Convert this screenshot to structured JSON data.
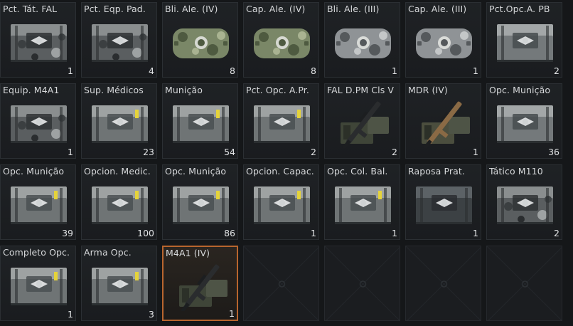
{
  "inventory": {
    "slots": [
      {
        "name": "Pct. Tát. FAL",
        "count": "1",
        "icon": "camo-crate-icon"
      },
      {
        "name": "Pct. Eqp. Pad.",
        "count": "4",
        "icon": "camo-crate-icon"
      },
      {
        "name": "Bli. Ale. (IV)",
        "count": "8",
        "icon": "green-camo-bag-icon"
      },
      {
        "name": "Cap. Ale. (IV)",
        "count": "8",
        "icon": "green-camo-bag-icon"
      },
      {
        "name": "Bli. Ale. (III)",
        "count": "1",
        "icon": "grey-camo-bag-icon"
      },
      {
        "name": "Cap. Ale. (III)",
        "count": "1",
        "icon": "grey-camo-bag-icon"
      },
      {
        "name": "Pct.Opc.A. PB",
        "count": "2",
        "icon": "metal-crate-icon"
      },
      {
        "name": "Equip. M4A1",
        "count": "1",
        "icon": "camo-crate-icon"
      },
      {
        "name": "Sup. Médicos",
        "count": "23",
        "icon": "ammo-crate-icon"
      },
      {
        "name": "Munição",
        "count": "54",
        "icon": "ammo-crate-icon"
      },
      {
        "name": "Pct. Opc. A.Pr.",
        "count": "2",
        "icon": "ammo-crate-icon"
      },
      {
        "name": "FAL D.PM Cls V",
        "count": "2",
        "icon": "rifle-crate-icon"
      },
      {
        "name": "MDR (IV)",
        "count": "1",
        "icon": "rifle-crate-tan-icon"
      },
      {
        "name": "Opc. Munição",
        "count": "36",
        "icon": "metal-crate-icon"
      },
      {
        "name": "Opc. Munição",
        "count": "39",
        "icon": "ammo-crate-icon"
      },
      {
        "name": "Opcion. Medic.",
        "count": "100",
        "icon": "ammo-crate-icon"
      },
      {
        "name": "Opc. Munição",
        "count": "86",
        "icon": "ammo-crate-icon"
      },
      {
        "name": "Opcion. Capac.",
        "count": "1",
        "icon": "ammo-crate-icon"
      },
      {
        "name": "Opc. Col. Bal.",
        "count": "1",
        "icon": "ammo-crate-icon"
      },
      {
        "name": "Raposa Prat.",
        "count": "1",
        "icon": "dark-case-icon"
      },
      {
        "name": "Tático M110",
        "count": "2",
        "icon": "camo-crate-icon"
      },
      {
        "name": "Completo Opc.",
        "count": "1",
        "icon": "ammo-crate-icon"
      },
      {
        "name": "Arma Opc.",
        "count": "3",
        "icon": "ammo-crate-icon"
      },
      {
        "name": "M4A1 (IV)",
        "count": "1",
        "icon": "rifle-crate-icon",
        "selected": true
      },
      {
        "name": "",
        "count": "",
        "icon": "empty-slot-icon"
      },
      {
        "name": "",
        "count": "",
        "icon": "empty-slot-icon"
      },
      {
        "name": "",
        "count": "",
        "icon": "empty-slot-icon"
      },
      {
        "name": "",
        "count": "",
        "icon": "empty-slot-icon"
      }
    ]
  },
  "colors": {
    "selected_border": "#b8652e",
    "text": "#d6d8da",
    "background": "#151719"
  }
}
